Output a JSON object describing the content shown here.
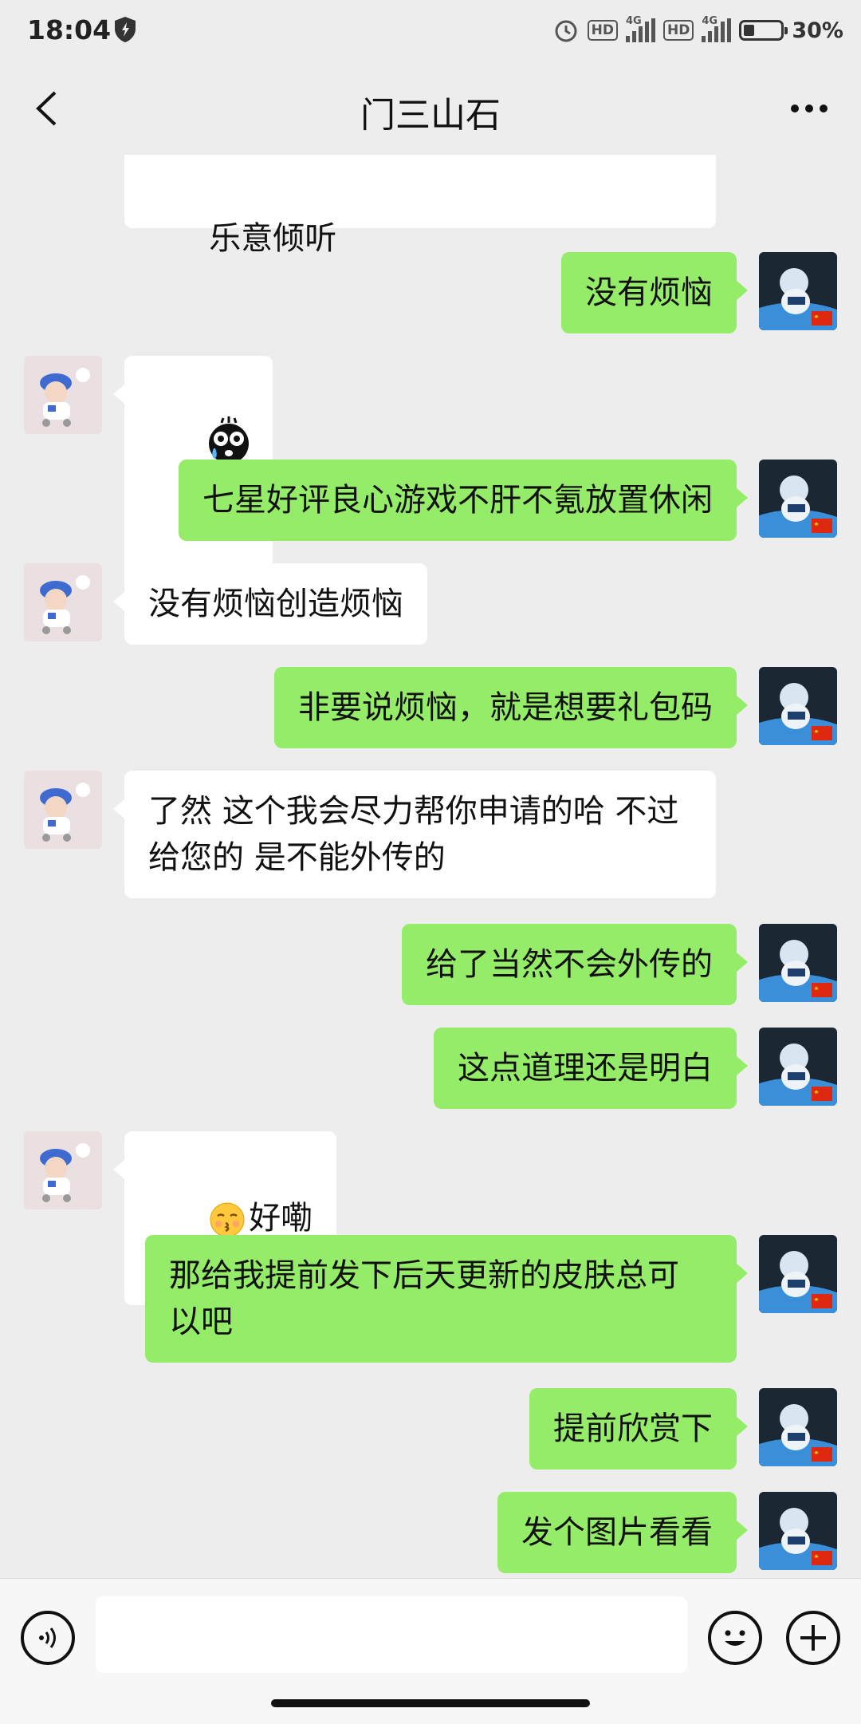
{
  "status_bar": {
    "time": "18:04",
    "battery": "30%",
    "battery_level": 0.3,
    "hd": "HD",
    "network": "4G"
  },
  "header": {
    "title": "门三山石",
    "back_icon": "chevron-left-icon",
    "more_icon": "more-dots-icon"
  },
  "messages": [
    {
      "side": "in",
      "text": "乐意倾听"
    },
    {
      "side": "out",
      "text": "没有烦恼"
    },
    {
      "side": "in",
      "text": "",
      "emoji": "crying-face-sticker"
    },
    {
      "side": "out",
      "text": "七星好评良心游戏不肝不氪放置休闲"
    },
    {
      "side": "in",
      "text": "没有烦恼创造烦恼"
    },
    {
      "side": "out",
      "text": "非要说烦恼，就是想要礼包码"
    },
    {
      "side": "in",
      "text": "了然 这个我会尽力帮你申请的哈 不过\n给您的 是不能外传的"
    },
    {
      "side": "out",
      "text": "给了当然不会外传的"
    },
    {
      "side": "out",
      "text": "这点道理还是明白"
    },
    {
      "side": "in",
      "text": "好嘞",
      "emoji": "kissing-face-emoji"
    },
    {
      "side": "out",
      "text": "那给我提前发下后天更新的皮肤总可\n以吧"
    },
    {
      "side": "out",
      "text": "提前欣赏下"
    },
    {
      "side": "out",
      "text": "发个图片看看"
    }
  ],
  "input_bar": {
    "voice_icon": "voice-icon",
    "emoji_icon": "emoji-icon",
    "plus_icon": "plus-icon",
    "text_value": ""
  },
  "colors": {
    "outgoing_bubble": "#95ec69",
    "incoming_bubble": "#ffffff",
    "background": "#ededed"
  }
}
